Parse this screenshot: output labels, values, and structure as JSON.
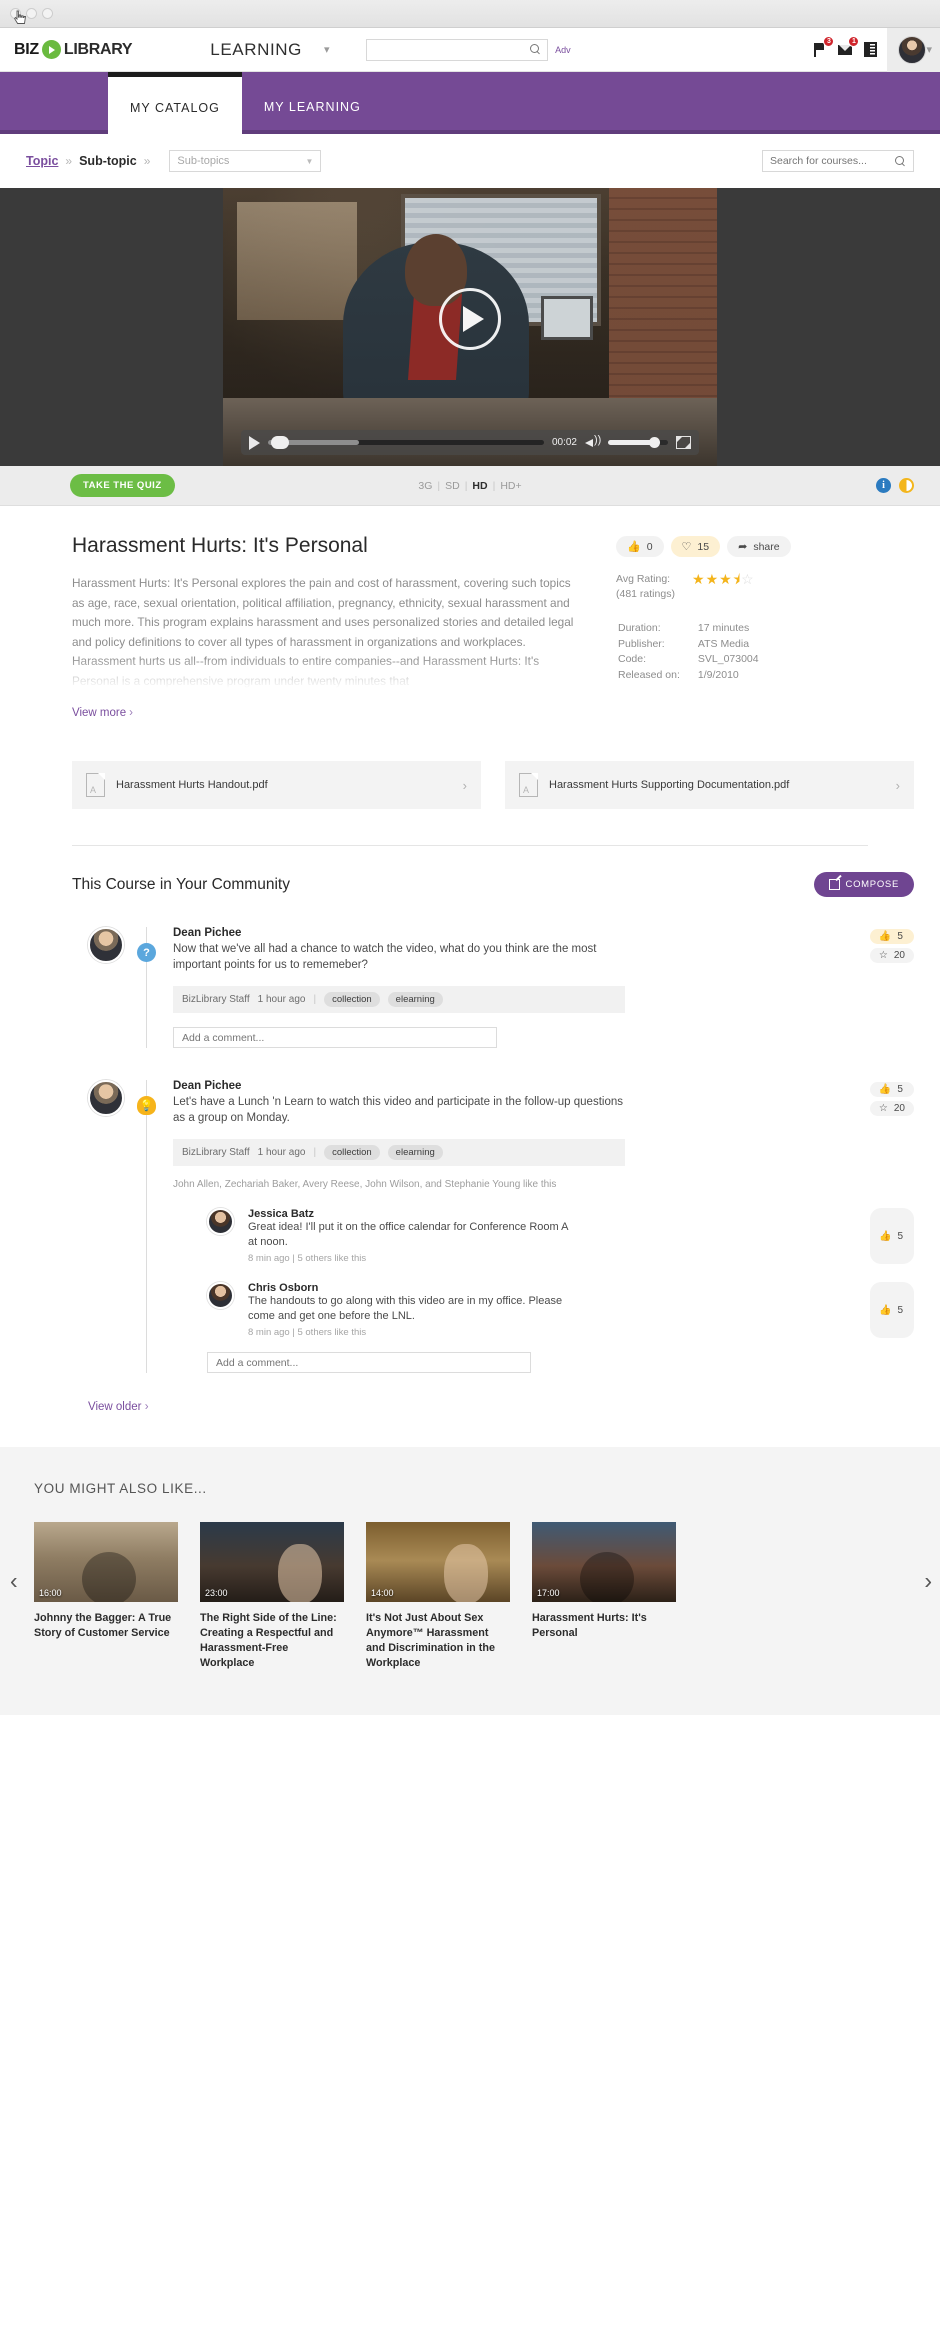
{
  "browser": {
    "dots": 3
  },
  "header": {
    "logo_biz": "BIZ",
    "logo_library": "LIBRARY",
    "mode_label": "LEARNING",
    "search_placeholder": "",
    "search_value": "",
    "advanced_label": "Adv",
    "flag_badge": "3",
    "mail_badge": "1"
  },
  "nav": {
    "tabs": [
      {
        "label": "MY CATALOG",
        "active": true
      },
      {
        "label": "MY LEARNING",
        "active": false
      }
    ]
  },
  "breadcrumb": {
    "topic": "Topic",
    "separator": "»",
    "subtopic": "Sub-topic",
    "select_value": "Sub-topics",
    "course_search_placeholder": "Search for courses..."
  },
  "player": {
    "time": "00:02",
    "play_label": "Play",
    "quiz_button": "TAKE THE QUIZ",
    "quality": [
      "3G",
      "SD",
      "HD",
      "HD+"
    ],
    "quality_selected": "HD",
    "info_icon": "i"
  },
  "course": {
    "title": "Harassment Hurts: It's Personal",
    "description": "Harassment Hurts: It's Personal explores the pain and cost of harassment, covering such topics as age, race, sexual orientation, political affiliation, pregnancy, ethnicity, sexual harassment and much more. This program explains harassment and uses personalized stories and detailed legal and policy definitions to cover all types of harassment in organizations and workplaces. Harassment hurts us all--from individuals to entire companies--and Harassment Hurts: It's Personal is a comprehensive program under twenty minutes that",
    "view_more": "View more",
    "chevron": "›",
    "like_count": "0",
    "heart_count": "15",
    "share_label": "share",
    "rating_label": "Avg Rating:",
    "rating_count": "(481 ratings)",
    "rating_value": 3.5,
    "meta": [
      {
        "label": "Duration:",
        "value": "17 minutes"
      },
      {
        "label": "Publisher:",
        "value": "ATS Media"
      },
      {
        "label": "Code:",
        "value": "SVL_073004"
      },
      {
        "label": "Released on:",
        "value": "1/9/2010"
      }
    ]
  },
  "attachments": [
    {
      "name": "Harassment Hurts Handout.pdf"
    },
    {
      "name": "Harassment Hurts Supporting Documentation.pdf"
    }
  ],
  "community": {
    "title": "This Course in Your Community",
    "compose_label": "COMPOSE",
    "comment_placeholder": "Add a comment...",
    "view_older": "View older",
    "posts": [
      {
        "author": "Dean Pichee",
        "badge": "question",
        "text": "Now that we've all had a chance to watch the video, what do you think are the most important points for us to rememeber?",
        "source": "BizLibrary Staff",
        "time": "1 hour ago",
        "tags": [
          "collection",
          "elearning"
        ],
        "like_count": "5",
        "star_count": "20",
        "likers": "",
        "replies": []
      },
      {
        "author": "Dean Pichee",
        "badge": "idea",
        "text": "Let's have a Lunch 'n Learn to watch this video and participate in the follow-up questions as a group on Monday.",
        "source": "BizLibrary Staff",
        "time": "1 hour ago",
        "tags": [
          "collection",
          "elearning"
        ],
        "like_count": "5",
        "star_count": "20",
        "likers": "John Allen, Zechariah Baker, Avery Reese, John Wilson, and Stephanie Young like this",
        "replies": [
          {
            "author": "Jessica Batz",
            "text": "Great idea! I'll put it on the office calendar for Conference Room A at noon.",
            "meta": "8 min ago | 5 others like this",
            "like_count": "5"
          },
          {
            "author": "Chris Osborn",
            "text": "The handouts to go along with this video are in my office. Please come and get one before the LNL.",
            "meta": "8 min ago | 5 others like this",
            "like_count": "5"
          }
        ]
      }
    ]
  },
  "recommendations": {
    "title": "YOU MIGHT ALSO LIKE...",
    "prev_arrow": "‹",
    "next_arrow": "›",
    "items": [
      {
        "duration": "16:00",
        "name": "Johnny the Bagger: A True Story of Customer Service"
      },
      {
        "duration": "23:00",
        "name": "The Right Side of the Line: Creating a Respectful and Harassment-Free Workplace"
      },
      {
        "duration": "14:00",
        "name": "It's Not Just About Sex Anymore™ Harassment and Discrimination in the Workplace"
      },
      {
        "duration": "17:00",
        "name": "Harassment Hurts: It's Personal"
      }
    ]
  },
  "colors": {
    "brand_purple": "#754a95",
    "accent_green": "#6cbd45",
    "star_gold": "#f4b41b",
    "badge_red": "#d0252c"
  }
}
